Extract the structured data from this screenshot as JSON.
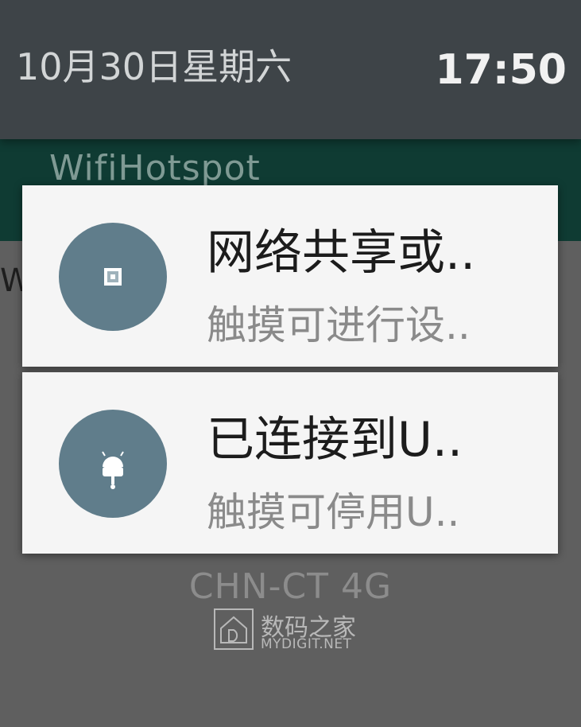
{
  "status_bar": {
    "date": "10月30日星期六",
    "time": "17:50"
  },
  "background": {
    "app_title": "WifiHotspot",
    "left_fragment": "W"
  },
  "notifications": [
    {
      "title": "网络共享或..",
      "subtitle": "触摸可进行设..",
      "icon": "hotspot-icon"
    },
    {
      "title": "已连接到U..",
      "subtitle": "触摸可停用U..",
      "icon": "usb-android-icon"
    }
  ],
  "carrier": "CHN-CT 4G",
  "watermark": {
    "name_cn": "数码之家",
    "name_en": "MYDIGIT.NET"
  },
  "colors": {
    "icon_bg": "#607d8b",
    "header_bg": "#3e4448",
    "card_bg": "#f5f5f5",
    "teal_app_bar": "#0f3b33"
  }
}
